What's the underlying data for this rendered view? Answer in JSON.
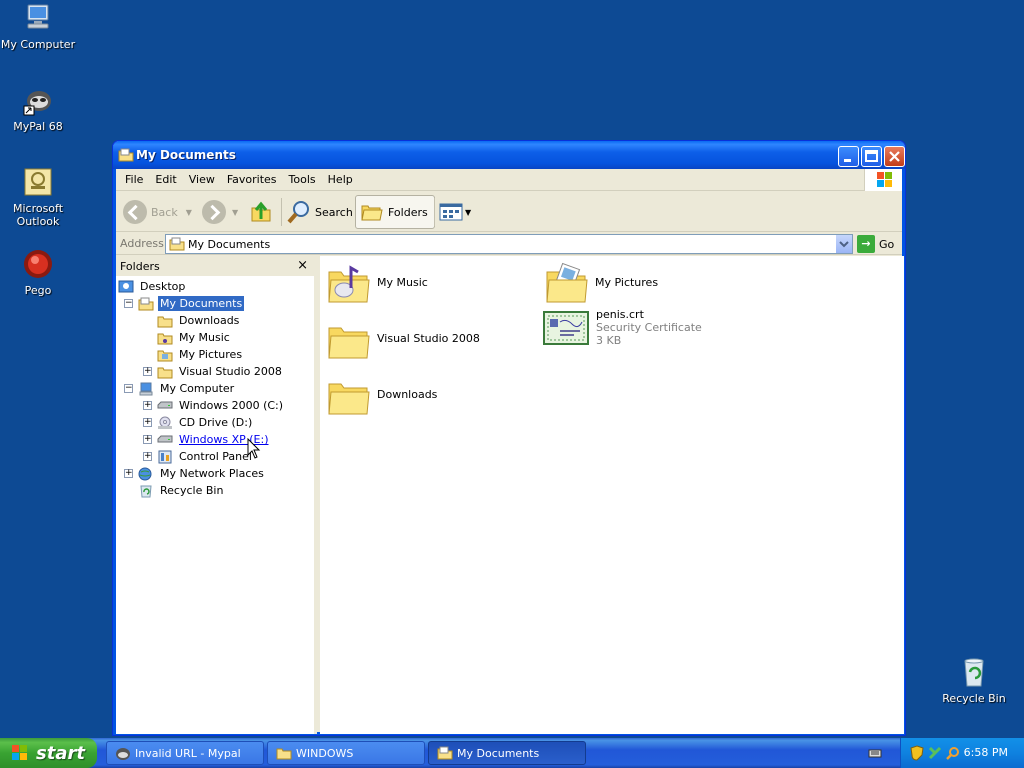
{
  "desktop": {
    "icons": [
      {
        "label": "My Computer",
        "icon": "my-computer-icon"
      },
      {
        "label": "MyPal 68",
        "icon": "mypal-icon"
      },
      {
        "label": "Microsoft Outlook",
        "icon": "outlook-icon"
      },
      {
        "label": "Pego",
        "icon": "pego-icon"
      },
      {
        "label": "Recycle Bin",
        "icon": "recycle-bin-icon"
      }
    ]
  },
  "window": {
    "title": "My Documents",
    "menu": [
      "File",
      "Edit",
      "View",
      "Favorites",
      "Tools",
      "Help"
    ],
    "toolbar": {
      "back": "Back",
      "search": "Search",
      "folders": "Folders"
    },
    "address": {
      "label": "Address",
      "value": "My Documents",
      "go": "Go"
    },
    "folders_pane": {
      "title": "Folders",
      "close": "×",
      "tree": [
        {
          "label": "Desktop",
          "level": 0,
          "expander": "",
          "selected": false
        },
        {
          "label": "My Documents",
          "level": 1,
          "expander": "−",
          "selected": true
        },
        {
          "label": "Downloads",
          "level": 2,
          "expander": "",
          "selected": false
        },
        {
          "label": "My Music",
          "level": 2,
          "expander": "",
          "selected": false
        },
        {
          "label": "My Pictures",
          "level": 2,
          "expander": "",
          "selected": false
        },
        {
          "label": "Visual Studio 2008",
          "level": 2,
          "expander": "+",
          "selected": false
        },
        {
          "label": "My Computer",
          "level": 1,
          "expander": "−",
          "selected": false
        },
        {
          "label": "Windows 2000 (C:)",
          "level": 2,
          "expander": "+",
          "selected": false
        },
        {
          "label": "CD Drive (D:)",
          "level": 2,
          "expander": "+",
          "selected": false
        },
        {
          "label": "Windows XP (E:)",
          "level": 2,
          "expander": "+",
          "selected": false,
          "hover": true
        },
        {
          "label": "Control Panel",
          "level": 2,
          "expander": "+",
          "selected": false
        },
        {
          "label": "My Network Places",
          "level": 1,
          "expander": "+",
          "selected": false
        },
        {
          "label": "Recycle Bin",
          "level": 1,
          "expander": "",
          "selected": false
        }
      ]
    },
    "content": {
      "items": [
        {
          "name": "My Music",
          "sub1": "",
          "sub2": "",
          "icon": "music-folder-icon"
        },
        {
          "name": "My Pictures",
          "sub1": "",
          "sub2": "",
          "icon": "pictures-folder-icon"
        },
        {
          "name": "Visual Studio 2008",
          "sub1": "",
          "sub2": "",
          "icon": "folder-icon"
        },
        {
          "name": "penis.crt",
          "sub1": "Security Certificate",
          "sub2": "3 KB",
          "icon": "certificate-icon"
        },
        {
          "name": "Downloads",
          "sub1": "",
          "sub2": "",
          "icon": "folder-icon"
        }
      ]
    }
  },
  "taskbar": {
    "start": "start",
    "tasks": [
      {
        "label": "Invalid URL - Mypal",
        "active": false
      },
      {
        "label": "WINDOWS",
        "active": false
      },
      {
        "label": "My Documents",
        "active": true
      }
    ],
    "clock": "6:58 PM"
  },
  "colors": {
    "desktop_bg": "#0d4a94",
    "selection": "#316ac5",
    "titlebar": "#0653de",
    "start_green": "#39a332"
  }
}
